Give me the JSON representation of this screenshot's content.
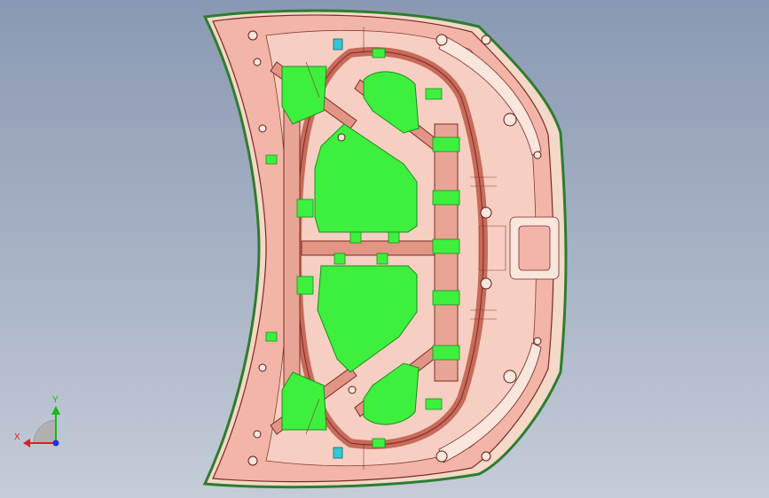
{
  "viewport": {
    "background_top": "#8a99b3",
    "background_bottom": "#c4ccd8"
  },
  "model": {
    "part": "hood-inner-panel",
    "colors": {
      "panel": "#f2b5a8",
      "panel_dark": "#e39585",
      "outline": "#7a2a22",
      "green_patch": "#3df03d",
      "green_edge": "#1f8a1f",
      "cyan_clip": "#33c8d8",
      "rim": "#f4d8c8",
      "edge_green": "#2e7d2e"
    }
  },
  "triad": {
    "x_label": "X",
    "y_label": "Y",
    "x_color": "#e02020",
    "y_color": "#18b818",
    "z_color": "#2030e0"
  }
}
